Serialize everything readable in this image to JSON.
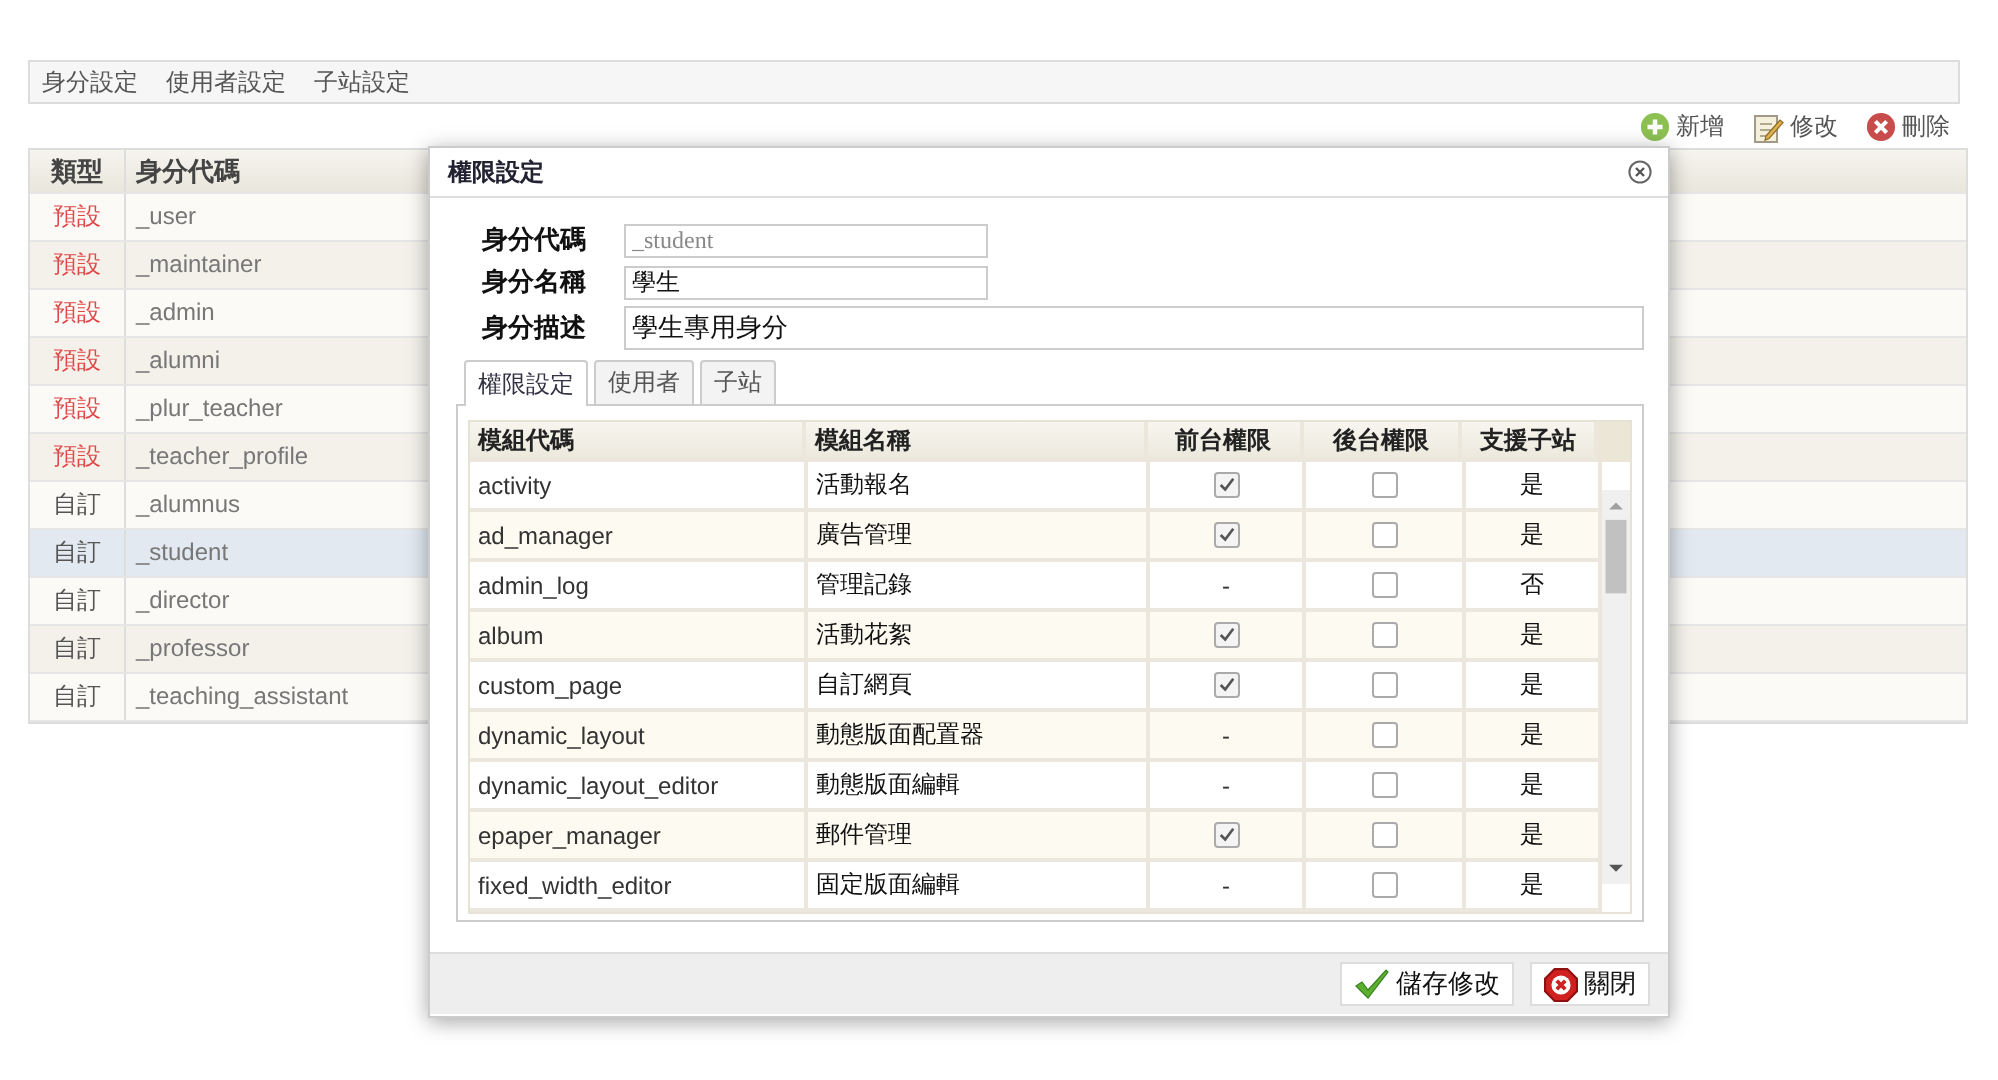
{
  "menu": [
    {
      "label": "身分設定"
    },
    {
      "label": "使用者設定"
    },
    {
      "label": "子站設定"
    }
  ],
  "toolbar": [
    {
      "label": "新增",
      "kind": "add"
    },
    {
      "label": "修改",
      "kind": "edit"
    },
    {
      "label": "刪除",
      "kind": "delete"
    }
  ],
  "roles": {
    "columns": [
      "類型",
      "身分代碼"
    ],
    "rows": [
      {
        "type": "預設",
        "kind": "default",
        "code": "_user",
        "selected": false
      },
      {
        "type": "預設",
        "kind": "default",
        "code": "_maintainer",
        "selected": false
      },
      {
        "type": "預設",
        "kind": "default",
        "code": "_admin",
        "selected": false
      },
      {
        "type": "預設",
        "kind": "default",
        "code": "_alumni",
        "selected": false
      },
      {
        "type": "預設",
        "kind": "default",
        "code": "_plur_teacher",
        "selected": false
      },
      {
        "type": "預設",
        "kind": "default",
        "code": "_teacher_profile",
        "selected": false
      },
      {
        "type": "自訂",
        "kind": "custom",
        "code": "_alumnus",
        "selected": false
      },
      {
        "type": "自訂",
        "kind": "custom",
        "code": "_student",
        "selected": true
      },
      {
        "type": "自訂",
        "kind": "custom",
        "code": "_director",
        "selected": false
      },
      {
        "type": "自訂",
        "kind": "custom",
        "code": "_professor",
        "selected": false
      },
      {
        "type": "自訂",
        "kind": "custom",
        "code": "_teaching_assistant",
        "selected": false
      }
    ]
  },
  "dialog": {
    "title": "權限設定",
    "fields": [
      {
        "label": "身分代碼",
        "value": "_student",
        "kind": "short",
        "disabled": true
      },
      {
        "label": "身分名稱",
        "value": "學生",
        "kind": "short",
        "disabled": false
      },
      {
        "label": "身分描述",
        "value": "學生專用身分",
        "kind": "wide",
        "disabled": false
      }
    ],
    "tabs": [
      {
        "label": "權限設定",
        "selected": true
      },
      {
        "label": "使用者",
        "selected": false
      },
      {
        "label": "子站",
        "selected": false
      }
    ],
    "grid": {
      "columns": [
        "模組代碼",
        "模組名稱",
        "前台權限",
        "後台權限",
        "支援子站"
      ],
      "rows": [
        {
          "code": "activity",
          "name": "活動報名",
          "front": {
            "kind": "checkbox",
            "checked": true
          },
          "backend_checked": false,
          "subsite": "是"
        },
        {
          "code": "ad_manager",
          "name": "廣告管理",
          "front": {
            "kind": "checkbox",
            "checked": true
          },
          "backend_checked": false,
          "subsite": "是"
        },
        {
          "code": "admin_log",
          "name": "管理記錄",
          "front": {
            "kind": "text",
            "text": "-"
          },
          "backend_checked": false,
          "subsite": "否"
        },
        {
          "code": "album",
          "name": "活動花絮",
          "front": {
            "kind": "checkbox",
            "checked": true
          },
          "backend_checked": false,
          "subsite": "是"
        },
        {
          "code": "custom_page",
          "name": "自訂網頁",
          "front": {
            "kind": "checkbox",
            "checked": true
          },
          "backend_checked": false,
          "subsite": "是"
        },
        {
          "code": "dynamic_layout",
          "name": "動態版面配置器",
          "front": {
            "kind": "text",
            "text": "-"
          },
          "backend_checked": false,
          "subsite": "是"
        },
        {
          "code": "dynamic_layout_editor",
          "name": "動態版面編輯",
          "front": {
            "kind": "text",
            "text": "-"
          },
          "backend_checked": false,
          "subsite": "是"
        },
        {
          "code": "epaper_manager",
          "name": "郵件管理",
          "front": {
            "kind": "checkbox",
            "checked": true
          },
          "backend_checked": false,
          "subsite": "是"
        },
        {
          "code": "fixed_width_editor",
          "name": "固定版面編輯",
          "front": {
            "kind": "text",
            "text": "-"
          },
          "backend_checked": false,
          "subsite": "是"
        }
      ]
    },
    "buttons": [
      {
        "label": "儲存修改",
        "kind": "save"
      },
      {
        "label": "關閉",
        "kind": "close"
      }
    ]
  }
}
